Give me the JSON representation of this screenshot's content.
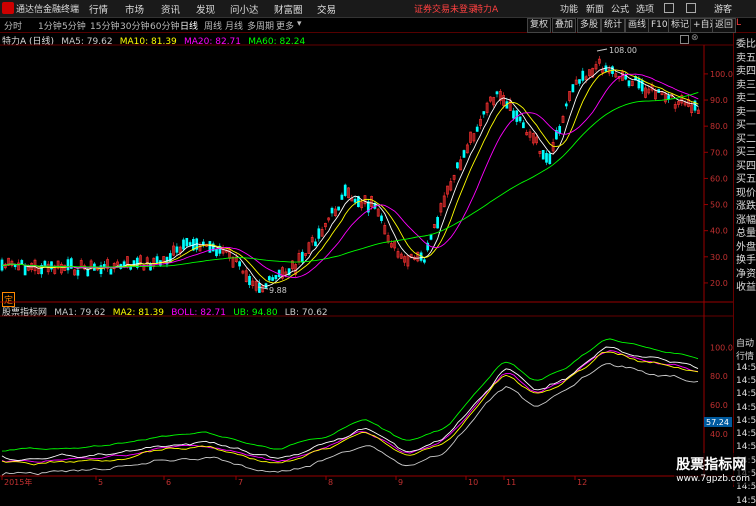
{
  "menubar": {
    "app_name": "通达信金融终端",
    "items": [
      "行情",
      "市场",
      "资讯",
      "发现",
      "问小达",
      "财富圈",
      "交易"
    ],
    "alert": "证券交易未登录",
    "stock": "特力A",
    "right_items": [
      "功能",
      "新面",
      "公式",
      "选项",
      "游客"
    ]
  },
  "periods": {
    "items": [
      "分时",
      "1分钟",
      "5分钟",
      "15分钟",
      "30分钟",
      "60分钟",
      "日线",
      "周线",
      "月线",
      "多周期",
      "更多"
    ],
    "active": "日线"
  },
  "toolbar": {
    "buttons": [
      "复权",
      "叠加",
      "多股",
      "统计",
      "画线",
      "F10",
      "标记",
      "+自选",
      "返回"
    ]
  },
  "main_chart": {
    "stock_label": "特力A (日线)",
    "ma": [
      {
        "label": "MA5: 79.62",
        "color": "#ffffff"
      },
      {
        "label": "MA10: 81.39",
        "color": "#ffff00"
      },
      {
        "label": "MA20: 82.71",
        "color": "#ff00ff"
      },
      {
        "label": "MA60: 82.24",
        "color": "#00ff00"
      }
    ],
    "high_marker": "108.00",
    "low_marker": "9.88",
    "y_ticks": [
      "100.0",
      "90.0",
      "80.0",
      "70.0",
      "60.0",
      "50.0",
      "40.0",
      "30.0",
      "20.0"
    ]
  },
  "indicator": {
    "name": "股票指标网",
    "labels": [
      {
        "label": "MA1: 79.62",
        "color": "#ffffff"
      },
      {
        "label": "MA2: 81.39",
        "color": "#ffff00"
      },
      {
        "label": "BOLL: 82.71",
        "color": "#ff00ff"
      },
      {
        "label": "UB: 94.80",
        "color": "#00ff00"
      },
      {
        "label": "LB: 70.62",
        "color": "#ffffff"
      }
    ],
    "y_ticks": [
      "100.0",
      "80.0",
      "60.0",
      "40.0"
    ],
    "current_value": "57.24"
  },
  "x_axis": {
    "labels": [
      "2015年",
      "5",
      "6",
      "7",
      "8",
      "9",
      "10",
      "11",
      "12"
    ]
  },
  "right_panel": {
    "top_mark": "L",
    "items": [
      "委比",
      "卖五",
      "卖四",
      "卖三",
      "卖二",
      "卖一",
      "买一",
      "买二",
      "买三",
      "买四",
      "买五",
      "现价",
      "涨跌",
      "涨幅",
      "总量",
      "外盘",
      "换手",
      "净资",
      "收益"
    ],
    "lower_items": [
      "自动",
      "行情",
      "14:50",
      "14:50",
      "14:50",
      "14:50",
      "14:50",
      "14:50",
      "14:50",
      "14:50",
      "14:50",
      "14:50",
      "14:50"
    ]
  },
  "small_mark": "定",
  "watermark": {
    "title": "股票指标网",
    "url": "www.7gpzb.com"
  },
  "colors": {
    "up": "#ff3232",
    "down": "#00ffff",
    "ma5": "#ffffff",
    "ma10": "#ffff00",
    "ma20": "#ff00ff",
    "ma60": "#00ff00"
  }
}
